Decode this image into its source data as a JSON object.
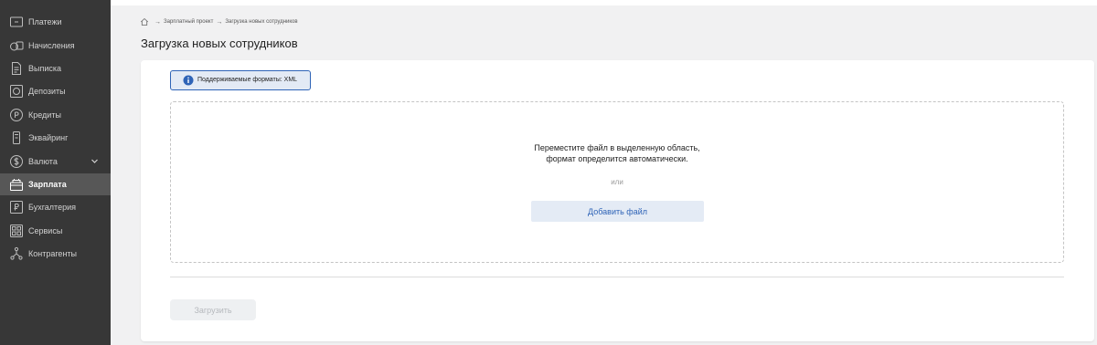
{
  "sidebar": {
    "items": [
      {
        "label": "Платежи",
        "icon": "payment-icon"
      },
      {
        "label": "Начисления",
        "icon": "coins-icon"
      },
      {
        "label": "Выписка",
        "icon": "document-icon"
      },
      {
        "label": "Депозиты",
        "icon": "deposit-icon"
      },
      {
        "label": "Кредиты",
        "icon": "credit-icon"
      },
      {
        "label": "Эквайринг",
        "icon": "terminal-icon"
      },
      {
        "label": "Валюта",
        "icon": "currency-icon"
      },
      {
        "label": "Зарплата",
        "icon": "salary-icon",
        "active": true
      },
      {
        "label": "Бухгалтерия",
        "icon": "accounting-icon"
      },
      {
        "label": "Сервисы",
        "icon": "services-icon"
      },
      {
        "label": "Контрагенты",
        "icon": "contractors-icon"
      }
    ]
  },
  "breadcrumb": {
    "items": [
      "Зарплатный проект",
      "Загрузка новых сотрудников"
    ]
  },
  "page": {
    "title": "Загрузка новых сотрудников"
  },
  "upload": {
    "formats_notice": "Поддерживаемые форматы: XML",
    "dropzone_line1": "Переместите файл в выделенную область,",
    "dropzone_line2": "формат определится автоматически.",
    "or_text": "или",
    "add_file_label": "Добавить файл",
    "submit_label": "Загрузить"
  },
  "colors": {
    "sidebar_bg": "#373737",
    "sidebar_active": "#575757",
    "accent": "#2f64b7",
    "page_bg": "#f1f1f2"
  }
}
